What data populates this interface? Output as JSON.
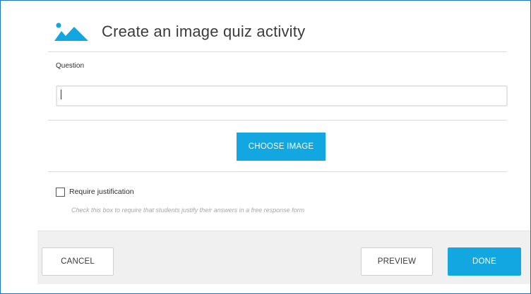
{
  "header": {
    "icon": "image-mountains-icon",
    "title": "Create an image quiz activity"
  },
  "question": {
    "label": "Question",
    "value": "",
    "placeholder": ""
  },
  "choose_image": {
    "label": "CHOOSE IMAGE"
  },
  "justification": {
    "checked": false,
    "label": "Require justification",
    "help_text": "Check this box to require that students justify their answers in a free response form"
  },
  "footer": {
    "cancel_label": "CANCEL",
    "preview_label": "PREVIEW",
    "done_label": "DONE"
  },
  "colors": {
    "accent": "#12a7e0",
    "frame_border": "#1f74c4",
    "footer_bg": "#f0f0f0"
  }
}
